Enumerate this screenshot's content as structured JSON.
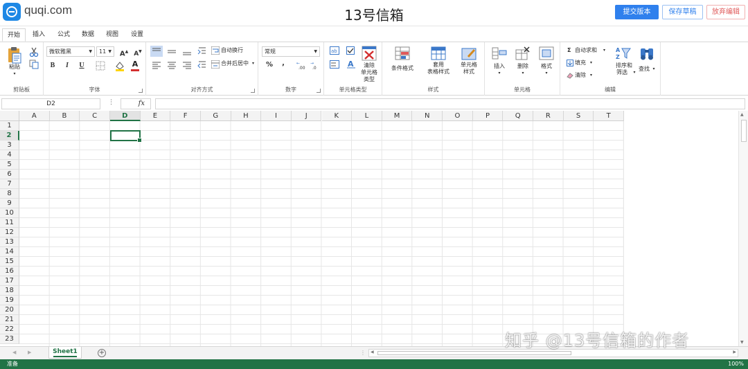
{
  "header": {
    "logo_text": "quqi.com",
    "doc_title": "13号信箱",
    "submit_label": "提交版本",
    "save_draft_label": "保存草稿",
    "discard_label": "放弃编辑"
  },
  "tabs": [
    "开始",
    "插入",
    "公式",
    "数据",
    "视图",
    "设置"
  ],
  "ribbon": {
    "clipboard": {
      "paste": "粘贴",
      "label": "剪贴板"
    },
    "font": {
      "family": "微软雅黑",
      "size": "11",
      "bold": "B",
      "italic": "I",
      "underline": "U",
      "color_a": "A",
      "label": "字体"
    },
    "alignment": {
      "wrap": "自动换行",
      "merge": "合并后居中",
      "label": "对齐方式"
    },
    "number": {
      "format": "常规",
      "percent": "%",
      "comma": ",",
      "label": "数字"
    },
    "cell_type": {
      "clear_line1": "清除",
      "clear_line2": "单元格",
      "clear_line3": "类型",
      "label": "单元格类型"
    },
    "styles": {
      "conditional": "条件格式",
      "table_line1": "套用",
      "table_line2": "表格样式",
      "cell_line1": "单元格",
      "cell_line2": "样式",
      "label": "样式"
    },
    "cells": {
      "insert": "插入",
      "delete": "删除",
      "format": "格式",
      "label": "单元格"
    },
    "editing": {
      "autosum": "自动求和",
      "fill": "填充",
      "clear": "清除",
      "sort_line1": "排序和",
      "sort_line2": "筛选",
      "find": "查找",
      "label": "编辑"
    }
  },
  "formula_bar": {
    "name_box": "D2",
    "fx": "fx",
    "dots": "⋮"
  },
  "grid": {
    "columns": [
      "A",
      "B",
      "C",
      "D",
      "E",
      "F",
      "G",
      "H",
      "I",
      "J",
      "K",
      "L",
      "M",
      "N",
      "O",
      "P",
      "Q",
      "R",
      "S",
      "T"
    ],
    "rows": [
      "1",
      "2",
      "3",
      "4",
      "5",
      "6",
      "7",
      "8",
      "9",
      "10",
      "11",
      "12",
      "13",
      "14",
      "15",
      "16",
      "17",
      "18",
      "19",
      "20",
      "21",
      "22",
      "23"
    ],
    "selected_column": "D",
    "selected_row": "2"
  },
  "sheets": {
    "active": "Sheet1",
    "add": "+"
  },
  "status": {
    "left": "准备",
    "zoom": "100%"
  },
  "watermark": "知乎 @13号信箱的作者",
  "colors": {
    "accent": "#217346",
    "primary_button": "#2f80ed",
    "danger": "#e05a5a"
  }
}
